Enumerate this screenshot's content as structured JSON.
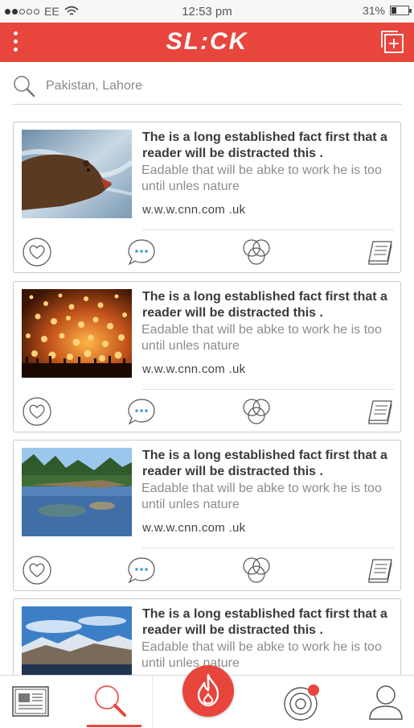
{
  "status_bar": {
    "carrier": "EE",
    "time": "12:53 pm",
    "battery": "31%",
    "battery_level": 0.31,
    "signal_bars_filled": 2,
    "signal_bars_total": 5
  },
  "header": {
    "logo": "SL:CK",
    "menu_icon": "more-vertical-icon",
    "add_icon": "add-stack-icon"
  },
  "search": {
    "placeholder": "Pakistan, Lahore",
    "icon": "search-icon"
  },
  "feed": [
    {
      "image": "bear-photo",
      "title": "The is a long established fact first that a reader will be distracted this  .",
      "description": "Eadable that will be abke to  work he is  too until unles nature",
      "source": "w.w.w.cnn.com .uk"
    },
    {
      "image": "lanterns-photo",
      "title": "The is a long established fact first that a reader will be distracted this  .",
      "description": "Eadable that will be abke to  work he is  too until unles nature",
      "source": "w.w.w.cnn.com .uk"
    },
    {
      "image": "lake-photo",
      "title": "The is a long established fact first that a reader will be distracted this  .",
      "description": "Eadable that will be abke to  work he is  too until unles nature",
      "source": "w.w.w.cnn.com .uk"
    },
    {
      "image": "mountain-photo",
      "title": "The is a long established fact first that a reader will be distracted this  .",
      "description": "Eadable that will be abke to  work he is  too until unles nature",
      "source": ""
    }
  ],
  "card_actions": [
    "heart-icon",
    "comment-icon",
    "circles-icon",
    "book-icon"
  ],
  "tabbar": {
    "items": [
      "news-icon",
      "search-icon",
      "fire-icon",
      "target-icon",
      "profile-icon"
    ],
    "active": "search-icon"
  },
  "colors": {
    "accent": "#e8453c",
    "comment_dots": "#3a9bd5",
    "notification_dot": "#e8453c"
  }
}
